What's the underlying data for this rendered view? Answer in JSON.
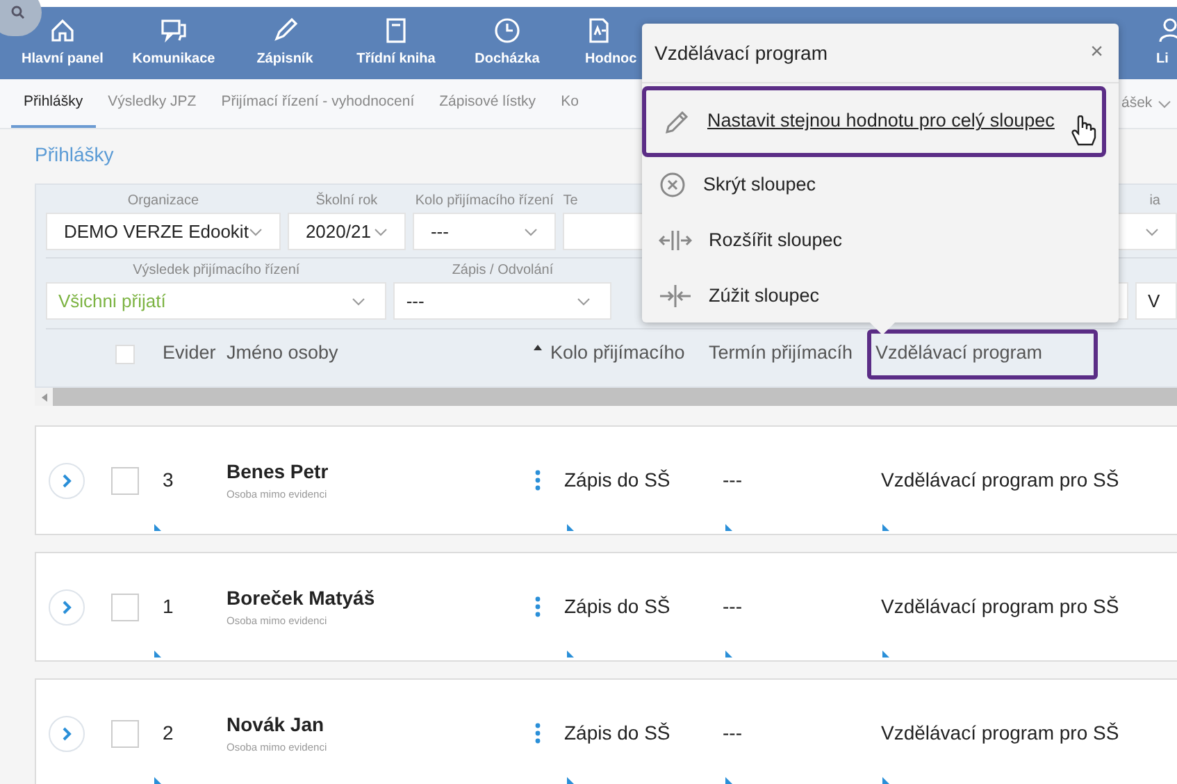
{
  "nav": [
    {
      "label": "Hlavní panel",
      "kind": "home"
    },
    {
      "label": "Komunikace",
      "kind": "chat"
    },
    {
      "label": "Zápisník",
      "kind": "pen"
    },
    {
      "label": "Třídní kniha",
      "kind": "book"
    },
    {
      "label": "Docházka",
      "kind": "clock"
    },
    {
      "label": "Hodnoc",
      "kind": "grade"
    }
  ],
  "nav_right": {
    "label": "Li",
    "kind": "user"
  },
  "subnav": {
    "tabs": [
      {
        "label": "Přihlášky",
        "selected": true
      },
      {
        "label": "Výsledky JPZ",
        "selected": false
      },
      {
        "label": "Přijímací řízení - vyhodnocení",
        "selected": false
      },
      {
        "label": "Zápisové lístky",
        "selected": false
      },
      {
        "label": "Ko",
        "selected": false
      }
    ],
    "trailing": "ášek"
  },
  "page_title": "Přihlášky",
  "filters_row_1": [
    {
      "label": "Organizace",
      "value": "DEMO VERZE Edookit",
      "color": "#222222",
      "kind": "dropdown"
    },
    {
      "label": "Školní rok",
      "value": "2020/21",
      "color": "#222222",
      "kind": "dropdown"
    },
    {
      "label": "Kolo přijímacího řízení",
      "value": "---",
      "color": "#222222",
      "kind": "dropdown"
    },
    {
      "label": "Te",
      "kind": "partial"
    },
    {
      "label": "ia",
      "kind": "dropdown"
    }
  ],
  "filters_row_2": [
    {
      "label": "Výsledek přijímacího řízení",
      "value": "Všichni přijatí",
      "color": "#7cb342",
      "kind": "dropdown"
    },
    {
      "label": "Zápis / Odvolání",
      "value": "---",
      "color": "#222222",
      "kind": "dropdown"
    },
    {
      "kind": "dropdown"
    },
    {
      "value": "V",
      "color": "#222222",
      "kind": "partial"
    }
  ],
  "table": {
    "select_all_checked": false,
    "columns": [
      {
        "label": "Evider",
        "sorted": false,
        "highlighted": false
      },
      {
        "label": "Jméno osoby",
        "sorted": true,
        "highlighted": false
      },
      {
        "label": "Kolo přijímacího",
        "sorted": false,
        "highlighted": false
      },
      {
        "label": "Termín přijímacíh",
        "sorted": false,
        "highlighted": false
      },
      {
        "label": "Vzdělávací program",
        "sorted": false,
        "highlighted": true
      }
    ],
    "rows": [
      {
        "number": "3",
        "name": "Benes Petr",
        "note": "Osoba mimo evidenci",
        "round": "Zápis do SŠ",
        "term": "---",
        "program": "Vzdělávací program pro SŠ",
        "checked": false
      },
      {
        "number": "1",
        "name": "Boreček Matyáš",
        "note": "Osoba mimo evidenci",
        "round": "Zápis do SŠ",
        "term": "---",
        "program": "Vzdělávací program pro SŠ",
        "checked": false
      },
      {
        "number": "2",
        "name": "Novák Jan",
        "note": "Osoba mimo evidenci",
        "round": "Zápis do SŠ",
        "term": "---",
        "program": "Vzdělávací program pro SŠ",
        "checked": false
      }
    ]
  },
  "popup": {
    "title": "Vzdělávací program",
    "close": "×",
    "items": [
      {
        "label": "Nastavit stejnou hodnotu pro celý sloupec",
        "kind": "edit",
        "highlighted": true
      },
      {
        "label": "Skrýt sloupec",
        "kind": "hide",
        "highlighted": false
      },
      {
        "label": "Rozšířit sloupec",
        "kind": "widen",
        "highlighted": false
      },
      {
        "label": "Zúžit sloupec",
        "kind": "narrow",
        "highlighted": false
      }
    ]
  }
}
